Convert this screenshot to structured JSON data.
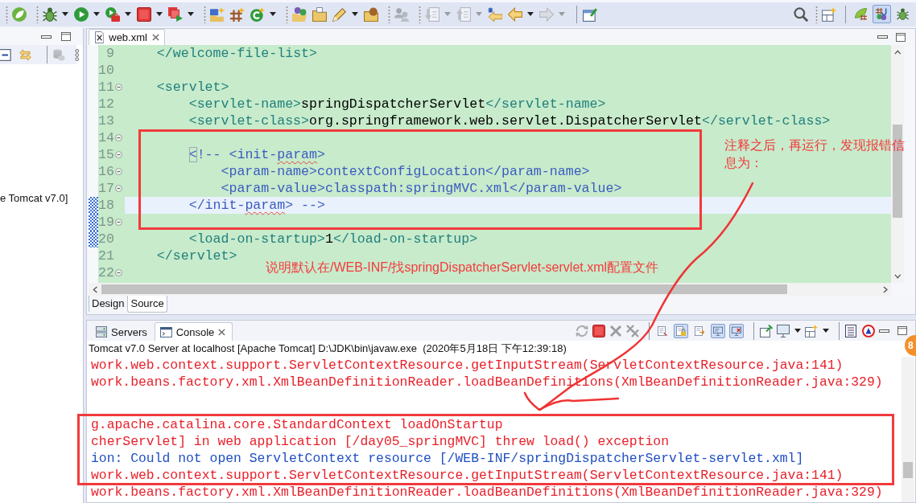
{
  "toolbar": {
    "groups": [
      {
        "items": [
          {
            "kind": "spring",
            "disabled": false,
            "menu": false
          }
        ]
      },
      {
        "items": [
          {
            "kind": "debug",
            "disabled": false,
            "menu": true
          },
          {
            "kind": "run",
            "disabled": false,
            "menu": true
          },
          {
            "kind": "external",
            "disabled": false,
            "menu": true
          },
          {
            "kind": "stop",
            "disabled": false,
            "menu": true
          },
          {
            "kind": "server",
            "disabled": false,
            "menu": true
          }
        ]
      },
      {
        "items": [
          {
            "kind": "aspect",
            "disabled": false,
            "menu": false
          },
          {
            "kind": "grid",
            "disabled": false,
            "menu": false
          },
          {
            "kind": "class",
            "disabled": false,
            "menu": true
          }
        ]
      },
      {
        "items": [
          {
            "kind": "openfolder",
            "disabled": false,
            "menu": false
          },
          {
            "kind": "folder",
            "disabled": false,
            "menu": false
          },
          {
            "kind": "pen",
            "disabled": false,
            "menu": true
          },
          {
            "kind": "package",
            "disabled": false,
            "menu": false
          }
        ]
      },
      {
        "items": [
          {
            "kind": "people",
            "disabled": true,
            "menu": false
          }
        ]
      },
      {
        "items": [
          {
            "kind": "docdown",
            "disabled": true,
            "menu": true
          },
          {
            "kind": "docup",
            "disabled": true,
            "menu": true
          },
          {
            "kind": "lastedit",
            "disabled": false,
            "menu": false
          },
          {
            "kind": "back",
            "disabled": false,
            "menu": true
          },
          {
            "kind": "forward",
            "disabled": true,
            "menu": true
          }
        ]
      },
      {
        "items": [
          {
            "kind": "windowpen",
            "disabled": false,
            "menu": false
          }
        ]
      }
    ],
    "right_tools": [
      {
        "kind": "search",
        "disabled": false,
        "menu": false
      },
      {
        "kind": "windowplus",
        "disabled": false,
        "menu": false
      }
    ],
    "perspectives": [
      {
        "kind": "javaee",
        "selected": false
      },
      {
        "kind": "java",
        "selected": true
      },
      {
        "kind": "debug",
        "selected": false
      }
    ]
  },
  "left_panel": {
    "toolbar": [
      {
        "kind": "collapse",
        "disabled": false
      },
      {
        "kind": "link",
        "disabled": false
      },
      {
        "kind": "database",
        "disabled": true
      },
      {
        "kind": "more",
        "disabled": false
      }
    ],
    "tree_items": [
      {
        "label": "e Tomcat v7.0]"
      }
    ]
  },
  "editor": {
    "tabs": [
      {
        "label": "web.xml",
        "selected": true
      }
    ],
    "lines": [
      {
        "number": "9",
        "fold": false,
        "current": false,
        "changed": false,
        "tokens": [
          {
            "kind": "tag",
            "text": "    </welcome-file-list>"
          }
        ]
      },
      {
        "number": "10",
        "fold": false,
        "current": false,
        "changed": false
      },
      {
        "number": "11",
        "fold": true,
        "current": false,
        "changed": false,
        "tokens": [
          {
            "kind": "tag",
            "text": "    <servlet>"
          }
        ]
      },
      {
        "number": "12",
        "fold": false,
        "current": false,
        "changed": false,
        "tokens": [
          {
            "kind": "tag",
            "text": "        <servlet-name>"
          },
          {
            "kind": "text",
            "text": "springDispatcherServlet"
          },
          {
            "kind": "tag",
            "text": "</servlet-name>"
          }
        ]
      },
      {
        "number": "13",
        "fold": false,
        "current": false,
        "changed": false,
        "tokens": [
          {
            "kind": "tag",
            "text": "        <servlet-class>"
          },
          {
            "kind": "text",
            "text": "org.springframework.web.servlet.DispatcherServlet"
          },
          {
            "kind": "tag",
            "text": "</servlet-class>"
          }
        ]
      },
      {
        "number": "14",
        "fold": true,
        "current": false,
        "changed": false
      },
      {
        "number": "15",
        "fold": true,
        "current": false,
        "changed": false,
        "tokens": [
          {
            "kind": "bracket",
            "text": "        <"
          },
          {
            "kind": "comment",
            "text": "!-- <init-"
          },
          {
            "kind": "typo",
            "text": "param"
          },
          {
            "kind": "comment",
            "text": ">"
          }
        ]
      },
      {
        "number": "16",
        "fold": true,
        "current": false,
        "changed": false,
        "tokens": [
          {
            "kind": "comment",
            "text": "            <param-name>contextConfigLocation</param-name>"
          }
        ]
      },
      {
        "number": "17",
        "fold": true,
        "current": false,
        "changed": false,
        "tokens": [
          {
            "kind": "comment",
            "text": "            <param-value>classpath:springMVC.xml</param-value>"
          }
        ]
      },
      {
        "number": "18",
        "fold": false,
        "current": true,
        "changed": true,
        "tokens": [
          {
            "kind": "comment",
            "text": "        </init-"
          },
          {
            "kind": "typo",
            "text": "param"
          },
          {
            "kind": "comment",
            "text": "> -->"
          }
        ]
      },
      {
        "number": "19",
        "fold": true,
        "current": false,
        "changed": true
      },
      {
        "number": "20",
        "fold": false,
        "current": false,
        "changed": true,
        "tokens": [
          {
            "kind": "tag",
            "text": "        <load-on-startup>"
          },
          {
            "kind": "text",
            "text": "1"
          },
          {
            "kind": "tag",
            "text": "</load-on-startup>"
          }
        ]
      },
      {
        "number": "21",
        "fold": false,
        "current": false,
        "changed": false,
        "tokens": [
          {
            "kind": "tag",
            "text": "    </servlet>"
          }
        ]
      },
      {
        "number": "22",
        "fold": true,
        "current": false,
        "changed": false
      }
    ],
    "bottom_tabs": [
      {
        "label": "Design",
        "selected": false
      },
      {
        "label": "Source",
        "selected": true
      }
    ]
  },
  "console": {
    "tabs": [
      {
        "kind": "servers",
        "label": "Servers",
        "selected": false
      },
      {
        "kind": "console",
        "label": "Console",
        "selected": true
      }
    ],
    "toolbar": [
      {
        "items": [
          {
            "kind": "relaunch",
            "disabled": true,
            "menu": false
          },
          {
            "kind": "terminate",
            "disabled": false,
            "menu": false
          },
          {
            "kind": "remove",
            "disabled": true,
            "menu": false
          },
          {
            "kind": "removeall",
            "disabled": true,
            "menu": false
          }
        ]
      },
      {
        "items": [
          {
            "kind": "clear",
            "disabled": false,
            "on": false
          },
          {
            "kind": "scrolllock",
            "disabled": false,
            "on": true
          },
          {
            "kind": "wordwrap",
            "disabled": false,
            "on": false
          },
          {
            "kind": "showout",
            "disabled": false,
            "on": true
          },
          {
            "kind": "showerr",
            "disabled": false,
            "on": true
          }
        ]
      },
      {
        "items": [
          {
            "kind": "pin",
            "disabled": false,
            "menu": false
          },
          {
            "kind": "display",
            "disabled": false,
            "menu": true
          },
          {
            "kind": "windowplus",
            "disabled": false,
            "menu": true
          }
        ]
      },
      {
        "items": [
          {
            "kind": "lines",
            "disabled": false,
            "menu": false
          },
          {
            "kind": "ant",
            "disabled": false,
            "menu": false
          }
        ]
      }
    ],
    "description": "Tomcat v7.0 Server at localhost [Apache Tomcat] D:\\JDK\\bin\\javaw.exe  (2020年5月18日 下午12:39:18)",
    "lines": [
      {
        "kind": "error",
        "text": "work.web.context.support.ServletContextResource.getInputStream(ServletContextResource.java:141)"
      },
      {
        "kind": "error",
        "text": "work.beans.factory.xml.XmlBeanDefinitionReader.loadBeanDefinitions(XmlBeanDefinitionReader.java:329)"
      },
      {
        "kind": "blank"
      },
      {
        "kind": "blank"
      },
      {
        "kind": "error",
        "text": "g.apache.catalina.core.StandardContext loadOnStartup"
      },
      {
        "kind": "error",
        "text": "cherServlet] in web application [/day05_springMVC] threw load() exception"
      },
      {
        "kind": "info",
        "text": "ion: Could not open ServletContext resource [/WEB-INF/springDispatcherServlet-servlet.xml]"
      },
      {
        "kind": "error",
        "text": "work.web.context.support.ServletContextResource.getInputStream(ServletContextResource.java:141)"
      },
      {
        "kind": "error",
        "text": "work.beans.factory.xml.XmlBeanDefinitionReader.loadBeanDefinitions(XmlBeanDefinitionReader.java:329)"
      }
    ]
  },
  "annotations": [
    {
      "text": "注释之后，再运行，发现报错信息为："
    },
    {
      "text": "说明默认在/WEB-INF/找springDispatcherServlet-servlet.xml配置文件"
    }
  ],
  "floating_badge": {
    "text": "8"
  }
}
